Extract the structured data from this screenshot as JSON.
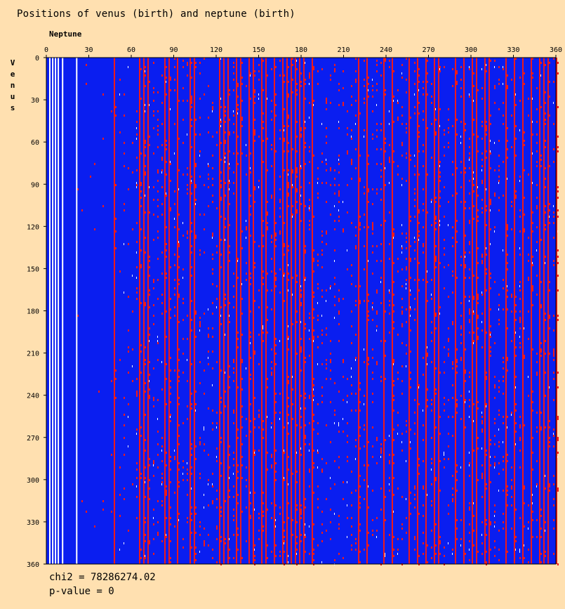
{
  "chart_data": {
    "type": "heatmap",
    "title": "Positions of venus (birth) and neptune (birth)",
    "xlabel": "Neptune",
    "ylabel": "Venus",
    "xlim": [
      0,
      360
    ],
    "ylim": [
      0,
      360
    ],
    "x_ticks": [
      0,
      30,
      60,
      90,
      120,
      150,
      180,
      210,
      240,
      270,
      300,
      330,
      360
    ],
    "y_ticks": [
      0,
      30,
      60,
      90,
      120,
      150,
      180,
      210,
      240,
      270,
      300,
      330,
      360
    ],
    "cell_colors": {
      "low": "#0a1ef0",
      "high": "#ee1a1a",
      "empty": "#ffffff"
    },
    "empty_columns_deg": [
      2,
      4,
      6,
      8,
      11,
      21
    ]
  },
  "stats": {
    "chi2": "chi2 = 78286274.02",
    "pvalue": "p-value = 0"
  }
}
